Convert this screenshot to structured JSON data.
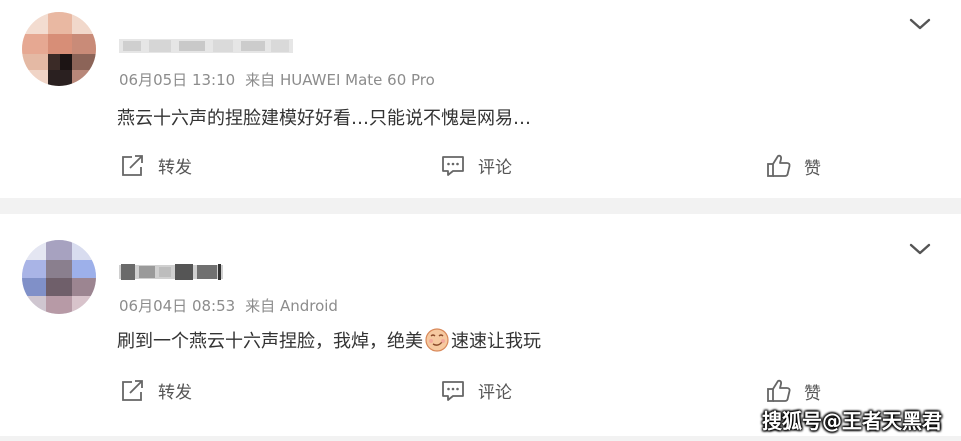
{
  "posts": [
    {
      "date": "06月05日 13:10",
      "source": "来自 HUAWEI Mate 60 Pro",
      "text": "燕云十六声的捏脸建模好好看…只能说不愧是网易…",
      "text_after_emoji": "",
      "actions": {
        "repost": "转发",
        "comment": "评论",
        "like": "赞"
      }
    },
    {
      "date": "06月04日 08:53",
      "source": "来自 Android",
      "text": "刷到一个燕云十六声捏脸，我焯，绝美",
      "emoji": "smirk-emoji",
      "text_after_emoji": "速速让我玩",
      "actions": {
        "repost": "转发",
        "comment": "评论",
        "like": "赞"
      }
    }
  ],
  "watermark": "搜狐号@王者天黑君",
  "colors": {
    "background": "#f2f2f2",
    "card": "#ffffff",
    "meta_text": "#8c8c8c",
    "body_text": "#333333",
    "icon": "#666666"
  }
}
